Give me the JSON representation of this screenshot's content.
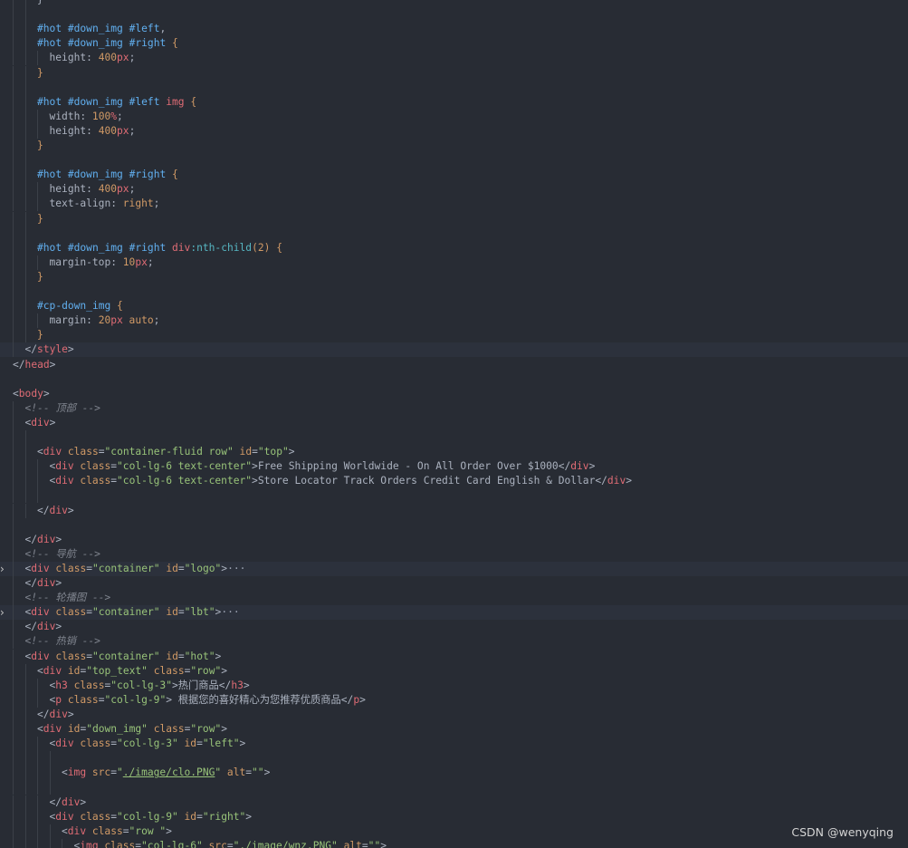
{
  "watermark": "CSDN @wenyqing",
  "lines": [
    {
      "indent": 2,
      "tokens": [
        [
          "}",
          "p"
        ]
      ]
    },
    {
      "indent": 2,
      "tokens": []
    },
    {
      "indent": 2,
      "tokens": [
        [
          "#hot #down_img #left",
          "id"
        ],
        [
          ",",
          "p"
        ]
      ]
    },
    {
      "indent": 2,
      "tokens": [
        [
          "#hot #down_img #right",
          "id"
        ],
        [
          " {",
          "a"
        ]
      ]
    },
    {
      "indent": 3,
      "tokens": [
        [
          "height",
          "pr"
        ],
        [
          ": ",
          "p"
        ],
        [
          "400",
          "n"
        ],
        [
          "px",
          "k"
        ],
        [
          ";",
          "p"
        ]
      ]
    },
    {
      "indent": 2,
      "tokens": [
        [
          "}",
          "a"
        ]
      ]
    },
    {
      "indent": 2,
      "tokens": []
    },
    {
      "indent": 2,
      "tokens": [
        [
          "#hot #down_img #left ",
          "id"
        ],
        [
          "img",
          "t"
        ],
        [
          " {",
          "a"
        ]
      ]
    },
    {
      "indent": 3,
      "tokens": [
        [
          "width",
          "pr"
        ],
        [
          ": ",
          "p"
        ],
        [
          "100",
          "n"
        ],
        [
          "%",
          "k"
        ],
        [
          ";",
          "p"
        ]
      ]
    },
    {
      "indent": 3,
      "tokens": [
        [
          "height",
          "pr"
        ],
        [
          ": ",
          "p"
        ],
        [
          "400",
          "n"
        ],
        [
          "px",
          "k"
        ],
        [
          ";",
          "p"
        ]
      ]
    },
    {
      "indent": 2,
      "tokens": [
        [
          "}",
          "a"
        ]
      ]
    },
    {
      "indent": 2,
      "tokens": []
    },
    {
      "indent": 2,
      "tokens": [
        [
          "#hot #down_img #right",
          "id"
        ],
        [
          " {",
          "a"
        ]
      ]
    },
    {
      "indent": 3,
      "tokens": [
        [
          "height",
          "pr"
        ],
        [
          ": ",
          "p"
        ],
        [
          "400",
          "n"
        ],
        [
          "px",
          "k"
        ],
        [
          ";",
          "p"
        ]
      ]
    },
    {
      "indent": 3,
      "tokens": [
        [
          "text-align",
          "pr"
        ],
        [
          ": ",
          "p"
        ],
        [
          "right",
          "v"
        ],
        [
          ";",
          "p"
        ]
      ]
    },
    {
      "indent": 2,
      "tokens": [
        [
          "}",
          "a"
        ]
      ]
    },
    {
      "indent": 2,
      "tokens": []
    },
    {
      "indent": 2,
      "tokens": [
        [
          "#hot #down_img #right ",
          "id"
        ],
        [
          "div",
          "t"
        ],
        [
          ":nth-child",
          "ps"
        ],
        [
          "(",
          "a"
        ],
        [
          "2",
          "n"
        ],
        [
          ")",
          "a"
        ],
        [
          " {",
          "a"
        ]
      ]
    },
    {
      "indent": 3,
      "tokens": [
        [
          "margin-top",
          "pr"
        ],
        [
          ": ",
          "p"
        ],
        [
          "10",
          "n"
        ],
        [
          "px",
          "k"
        ],
        [
          ";",
          "p"
        ]
      ]
    },
    {
      "indent": 2,
      "tokens": [
        [
          "}",
          "a"
        ]
      ]
    },
    {
      "indent": 2,
      "tokens": []
    },
    {
      "indent": 2,
      "tokens": [
        [
          "#cp-down_img",
          "id"
        ],
        [
          " {",
          "a"
        ]
      ]
    },
    {
      "indent": 3,
      "tokens": [
        [
          "margin",
          "pr"
        ],
        [
          ": ",
          "p"
        ],
        [
          "20",
          "n"
        ],
        [
          "px",
          "k"
        ],
        [
          " auto",
          "v"
        ],
        [
          ";",
          "p"
        ]
      ]
    },
    {
      "indent": 2,
      "tokens": [
        [
          "}",
          "a"
        ]
      ]
    },
    {
      "indent": 1,
      "hl": true,
      "tokens": [
        [
          "</",
          "p"
        ],
        [
          "style",
          "t"
        ],
        [
          ">",
          "p"
        ]
      ]
    },
    {
      "indent": 0,
      "tokens": [
        [
          "</",
          "p"
        ],
        [
          "head",
          "t"
        ],
        [
          ">",
          "p"
        ]
      ]
    },
    {
      "indent": 0,
      "tokens": []
    },
    {
      "indent": 0,
      "tokens": [
        [
          "<",
          "p"
        ],
        [
          "body",
          "t"
        ],
        [
          ">",
          "p"
        ]
      ]
    },
    {
      "indent": 1,
      "tokens": [
        [
          "<!-- 顶部 -->",
          "c"
        ]
      ]
    },
    {
      "indent": 1,
      "tokens": [
        [
          "<",
          "p"
        ],
        [
          "div",
          "t"
        ],
        [
          ">",
          "p"
        ]
      ]
    },
    {
      "indent": 2,
      "tokens": []
    },
    {
      "indent": 2,
      "tokens": [
        [
          "<",
          "p"
        ],
        [
          "div",
          "t"
        ],
        [
          " class",
          "a"
        ],
        [
          "=",
          "p"
        ],
        [
          "\"container-fluid row\"",
          "s"
        ],
        [
          " id",
          "a"
        ],
        [
          "=",
          "p"
        ],
        [
          "\"top\"",
          "s"
        ],
        [
          ">",
          "p"
        ]
      ]
    },
    {
      "indent": 3,
      "tokens": [
        [
          "<",
          "p"
        ],
        [
          "div",
          "t"
        ],
        [
          " class",
          "a"
        ],
        [
          "=",
          "p"
        ],
        [
          "\"col-lg-6 text-center\"",
          "s"
        ],
        [
          ">",
          "p"
        ],
        [
          "Free Shipping Worldwide - On All Order Over $1000",
          "x"
        ],
        [
          "</",
          "p"
        ],
        [
          "div",
          "t"
        ],
        [
          ">",
          "p"
        ]
      ]
    },
    {
      "indent": 3,
      "tokens": [
        [
          "<",
          "p"
        ],
        [
          "div",
          "t"
        ],
        [
          " class",
          "a"
        ],
        [
          "=",
          "p"
        ],
        [
          "\"col-lg-6 text-center\"",
          "s"
        ],
        [
          ">",
          "p"
        ],
        [
          "Store Locator Track Orders Credit Card English & Dollar",
          "x"
        ],
        [
          "</",
          "p"
        ],
        [
          "div",
          "t"
        ],
        [
          ">",
          "p"
        ]
      ]
    },
    {
      "indent": 3,
      "tokens": []
    },
    {
      "indent": 2,
      "tokens": [
        [
          "</",
          "p"
        ],
        [
          "div",
          "t"
        ],
        [
          ">",
          "p"
        ]
      ]
    },
    {
      "indent": 1,
      "tokens": []
    },
    {
      "indent": 1,
      "tokens": [
        [
          "</",
          "p"
        ],
        [
          "div",
          "t"
        ],
        [
          ">",
          "p"
        ]
      ]
    },
    {
      "indent": 1,
      "tokens": [
        [
          "<!-- 导航 -->",
          "c"
        ]
      ]
    },
    {
      "indent": 1,
      "hl": true,
      "fold": true,
      "tokens": [
        [
          "<",
          "p"
        ],
        [
          "div",
          "t"
        ],
        [
          " class",
          "a"
        ],
        [
          "=",
          "p"
        ],
        [
          "\"container\"",
          "s"
        ],
        [
          " id",
          "a"
        ],
        [
          "=",
          "p"
        ],
        [
          "\"logo\"",
          "s"
        ],
        [
          ">",
          "p"
        ],
        [
          "···",
          "dots"
        ]
      ]
    },
    {
      "indent": 1,
      "tokens": [
        [
          "</",
          "p"
        ],
        [
          "div",
          "t"
        ],
        [
          ">",
          "p"
        ]
      ]
    },
    {
      "indent": 1,
      "tokens": [
        [
          "<!-- 轮播图 -->",
          "c"
        ]
      ]
    },
    {
      "indent": 1,
      "hl": true,
      "fold": true,
      "tokens": [
        [
          "<",
          "p"
        ],
        [
          "div",
          "t"
        ],
        [
          " class",
          "a"
        ],
        [
          "=",
          "p"
        ],
        [
          "\"container\"",
          "s"
        ],
        [
          " id",
          "a"
        ],
        [
          "=",
          "p"
        ],
        [
          "\"lbt\"",
          "s"
        ],
        [
          ">",
          "p"
        ],
        [
          "···",
          "dots"
        ]
      ]
    },
    {
      "indent": 1,
      "tokens": [
        [
          "</",
          "p"
        ],
        [
          "div",
          "t"
        ],
        [
          ">",
          "p"
        ]
      ]
    },
    {
      "indent": 1,
      "tokens": [
        [
          "<!-- 热销 -->",
          "c"
        ]
      ]
    },
    {
      "indent": 1,
      "tokens": [
        [
          "<",
          "p"
        ],
        [
          "div",
          "t"
        ],
        [
          " class",
          "a"
        ],
        [
          "=",
          "p"
        ],
        [
          "\"container\"",
          "s"
        ],
        [
          " id",
          "a"
        ],
        [
          "=",
          "p"
        ],
        [
          "\"hot\"",
          "s"
        ],
        [
          ">",
          "p"
        ]
      ]
    },
    {
      "indent": 2,
      "tokens": [
        [
          "<",
          "p"
        ],
        [
          "div",
          "t"
        ],
        [
          " id",
          "a"
        ],
        [
          "=",
          "p"
        ],
        [
          "\"top_text\"",
          "s"
        ],
        [
          " class",
          "a"
        ],
        [
          "=",
          "p"
        ],
        [
          "\"row\"",
          "s"
        ],
        [
          ">",
          "p"
        ]
      ]
    },
    {
      "indent": 3,
      "tokens": [
        [
          "<",
          "p"
        ],
        [
          "h3",
          "t"
        ],
        [
          " class",
          "a"
        ],
        [
          "=",
          "p"
        ],
        [
          "\"col-lg-3\"",
          "s"
        ],
        [
          ">",
          "p"
        ],
        [
          "热门商品",
          "x"
        ],
        [
          "</",
          "p"
        ],
        [
          "h3",
          "t"
        ],
        [
          ">",
          "p"
        ]
      ]
    },
    {
      "indent": 3,
      "tokens": [
        [
          "<",
          "p"
        ],
        [
          "p",
          "t"
        ],
        [
          " class",
          "a"
        ],
        [
          "=",
          "p"
        ],
        [
          "\"col-lg-9\"",
          "s"
        ],
        [
          ">",
          "p"
        ],
        [
          " 根据您的喜好精心为您推荐优质商品",
          "x"
        ],
        [
          "</",
          "p"
        ],
        [
          "p",
          "t"
        ],
        [
          ">",
          "p"
        ]
      ]
    },
    {
      "indent": 2,
      "tokens": [
        [
          "</",
          "p"
        ],
        [
          "div",
          "t"
        ],
        [
          ">",
          "p"
        ]
      ]
    },
    {
      "indent": 2,
      "tokens": [
        [
          "<",
          "p"
        ],
        [
          "div",
          "t"
        ],
        [
          " id",
          "a"
        ],
        [
          "=",
          "p"
        ],
        [
          "\"down_img\"",
          "s"
        ],
        [
          " class",
          "a"
        ],
        [
          "=",
          "p"
        ],
        [
          "\"row\"",
          "s"
        ],
        [
          ">",
          "p"
        ]
      ]
    },
    {
      "indent": 3,
      "tokens": [
        [
          "<",
          "p"
        ],
        [
          "div",
          "t"
        ],
        [
          " class",
          "a"
        ],
        [
          "=",
          "p"
        ],
        [
          "\"col-lg-3\"",
          "s"
        ],
        [
          " id",
          "a"
        ],
        [
          "=",
          "p"
        ],
        [
          "\"left\"",
          "s"
        ],
        [
          ">",
          "p"
        ]
      ]
    },
    {
      "indent": 4,
      "tokens": []
    },
    {
      "indent": 4,
      "tokens": [
        [
          "<",
          "p"
        ],
        [
          "img",
          "t"
        ],
        [
          " src",
          "a"
        ],
        [
          "=",
          "p"
        ],
        [
          "\"",
          "s"
        ],
        [
          "./image/clo.PNG",
          "u"
        ],
        [
          "\"",
          "s"
        ],
        [
          " alt",
          "a"
        ],
        [
          "=",
          "p"
        ],
        [
          "\"\"",
          "s"
        ],
        [
          ">",
          "p"
        ]
      ]
    },
    {
      "indent": 4,
      "tokens": []
    },
    {
      "indent": 3,
      "tokens": [
        [
          "</",
          "p"
        ],
        [
          "div",
          "t"
        ],
        [
          ">",
          "p"
        ]
      ]
    },
    {
      "indent": 3,
      "tokens": [
        [
          "<",
          "p"
        ],
        [
          "div",
          "t"
        ],
        [
          " class",
          "a"
        ],
        [
          "=",
          "p"
        ],
        [
          "\"col-lg-9\"",
          "s"
        ],
        [
          " id",
          "a"
        ],
        [
          "=",
          "p"
        ],
        [
          "\"right\"",
          "s"
        ],
        [
          ">",
          "p"
        ]
      ]
    },
    {
      "indent": 4,
      "tokens": [
        [
          "<",
          "p"
        ],
        [
          "div",
          "t"
        ],
        [
          " class",
          "a"
        ],
        [
          "=",
          "p"
        ],
        [
          "\"row \"",
          "s"
        ],
        [
          ">",
          "p"
        ]
      ]
    },
    {
      "indent": 5,
      "tokens": [
        [
          "<",
          "p"
        ],
        [
          "img",
          "t"
        ],
        [
          " class",
          "a"
        ],
        [
          "=",
          "p"
        ],
        [
          "\"col-lg-6\"",
          "s"
        ],
        [
          " src",
          "a"
        ],
        [
          "=",
          "p"
        ],
        [
          "\"./image/wnz.PNG\"",
          "s"
        ],
        [
          " alt",
          "a"
        ],
        [
          "=",
          "p"
        ],
        [
          "\"\"",
          "s"
        ],
        [
          ">",
          "p"
        ]
      ]
    }
  ]
}
